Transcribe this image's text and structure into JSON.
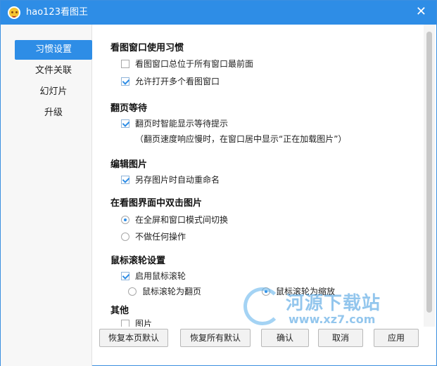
{
  "window": {
    "title": "hao123看图王",
    "close_glyph": "✕"
  },
  "sidebar": {
    "items": [
      {
        "label": "习惯设置",
        "active": true
      },
      {
        "label": "文件关联",
        "active": false
      },
      {
        "label": "幻灯片",
        "active": false
      },
      {
        "label": "升级",
        "active": false
      }
    ]
  },
  "sections": {
    "view_window": {
      "title": "看图窗口使用习惯",
      "always_on_top": {
        "label": "看图窗口总位于所有窗口最前面",
        "checked": false
      },
      "multi_window": {
        "label": "允许打开多个看图窗口",
        "checked": true
      }
    },
    "page_wait": {
      "title": "翻页等待",
      "smart_hint": {
        "label": "翻页时智能显示等待提示",
        "checked": true
      },
      "note": "（翻页速度响应慢时，在窗口居中显示“正在加载图片”）"
    },
    "edit_image": {
      "title": "编辑图片",
      "auto_rename": {
        "label": "另存图片时自动重命名",
        "checked": true
      }
    },
    "double_click": {
      "title": "在看图界面中双击图片",
      "toggle_fullscreen": {
        "label": "在全屏和窗口模式间切换",
        "checked": true
      },
      "no_action": {
        "label": "不做任何操作",
        "checked": false
      }
    },
    "mouse_wheel": {
      "title": "鼠标滚轮设置",
      "enable_wheel": {
        "label": "启用鼠标滚轮",
        "checked": true
      },
      "wheel_page": {
        "label": "鼠标滚轮为翻页",
        "checked": false
      },
      "wheel_zoom": {
        "label": "鼠标滚轮为缩放",
        "checked": true
      }
    },
    "other": {
      "title": "其他",
      "partial": {
        "label": "图片"
      }
    }
  },
  "footer": {
    "restore_page": "恢复本页默认",
    "restore_all": "恢复所有默认",
    "ok": "确认",
    "cancel": "取消",
    "apply": "应用"
  },
  "watermark": {
    "text": "河源下载站",
    "url": "www.xz7.com"
  },
  "colors": {
    "accent": "#2e8de6",
    "border": "#3b8fe0"
  }
}
